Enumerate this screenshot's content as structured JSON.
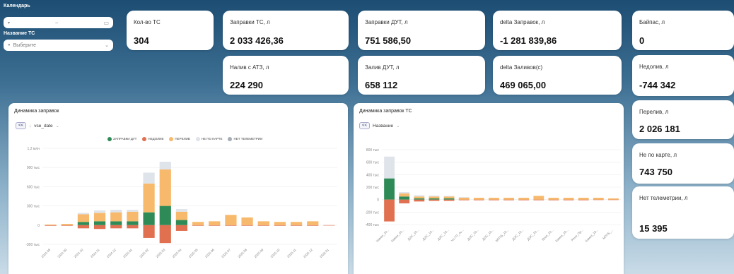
{
  "filters": {
    "calendar_label": "Календарь",
    "calendar_value": "–",
    "vehicle_label": "Название ТС",
    "vehicle_placeholder": "Выберите"
  },
  "kpis": {
    "vehicles": {
      "label": "Кол-во ТС",
      "value": "304"
    },
    "refuel_vehicle": {
      "label": "Заправки ТС, л",
      "value": "2 033 426,36"
    },
    "refuel_dut": {
      "label": "Заправки ДУТ, л",
      "value": "751 586,50"
    },
    "delta_refuel": {
      "label": "delta Заправок, л",
      "value": "-1 281 839,86"
    },
    "bypass": {
      "label": "Байпас, л",
      "value": "0"
    },
    "atz_fill": {
      "label": "Налив с АТЗ, л",
      "value": "224 290"
    },
    "dut_fill": {
      "label": "Залив ДУТ, л",
      "value": "658 112"
    },
    "delta_fill": {
      "label": "delta Заливов(с)",
      "value": "469 065,00"
    },
    "underfill": {
      "label": "Недолив, л",
      "value": "-744 342"
    },
    "overfill": {
      "label": "Перелив, л",
      "value": "2 026 181"
    },
    "off_card": {
      "label": "Не по карте, л",
      "value": "743 750"
    },
    "no_telemetry": {
      "label": "Нет телеметрии, л",
      "value": "15 395"
    }
  },
  "chart1": {
    "title": "Динамика заправок",
    "back_label": "<<",
    "field_label": "vse_date",
    "legend": [
      "ЗАПРАВКИ ДУТ",
      "НЕДОЛИВ",
      "ПЕРЕЛИВ",
      "НЕ ПО КАРТЕ",
      "НЕТ ТЕЛЕМЕТРИИ"
    ]
  },
  "chart2": {
    "title": "Динамика заправок ТС",
    "back_label": "<<",
    "field_label": "Название"
  },
  "colors": {
    "dut": "#2e8b57",
    "underfill": "#e07050",
    "overfill": "#f7b96b",
    "off_card": "#dfe3ea",
    "no_telemetry": "#a7adb5"
  },
  "chart_data": [
    {
      "type": "bar",
      "stacked": true,
      "title": "Динамика заправок",
      "ytick_labels": [
        "1,2 млн",
        "900 тыс",
        "600 тыс",
        "300 тыс",
        "0",
        "-300 тыс"
      ],
      "yticks": [
        1200000,
        900000,
        600000,
        300000,
        0,
        -300000
      ],
      "ylim": [
        -300000,
        1200000
      ],
      "categories": [
        "2024.08",
        "2024.09",
        "2024.10",
        "2024.11",
        "2024.12",
        "2025.01",
        "2025.02",
        "2025.03",
        "2025.04",
        "2025.05",
        "2025.06",
        "2025.07",
        "2025.08",
        "2025.09",
        "2025.10",
        "2025.11",
        "2025.12",
        "2026.01"
      ],
      "series": [
        {
          "name": "ЗАПРАВКИ ДУТ",
          "color": "#2e8b57",
          "values": [
            0,
            0,
            50000,
            60000,
            60000,
            60000,
            200000,
            300000,
            80000,
            0,
            0,
            0,
            0,
            0,
            0,
            0,
            0,
            0
          ]
        },
        {
          "name": "НЕДОЛИВ",
          "color": "#e07050",
          "values": [
            -10000,
            -10000,
            -50000,
            -60000,
            -50000,
            -50000,
            -200000,
            -280000,
            -90000,
            -10000,
            -10000,
            -10000,
            -10000,
            -10000,
            -10000,
            -10000,
            -10000,
            -5000
          ]
        },
        {
          "name": "ПЕРЕЛИВ",
          "color": "#f7b96b",
          "values": [
            10000,
            20000,
            120000,
            130000,
            140000,
            150000,
            450000,
            570000,
            130000,
            50000,
            60000,
            160000,
            120000,
            60000,
            50000,
            50000,
            60000,
            0
          ]
        },
        {
          "name": "НЕ ПО КАРТЕ",
          "color": "#dfe3ea",
          "values": [
            0,
            0,
            20000,
            40000,
            40000,
            30000,
            170000,
            120000,
            40000,
            0,
            0,
            0,
            0,
            0,
            0,
            0,
            0,
            0
          ]
        },
        {
          "name": "НЕТ ТЕЛЕМЕТРИИ",
          "color": "#a7adb5",
          "values": [
            0,
            0,
            0,
            0,
            0,
            0,
            0,
            0,
            0,
            0,
            0,
            0,
            0,
            0,
            0,
            0,
            0,
            0
          ]
        }
      ]
    },
    {
      "type": "bar",
      "stacked": true,
      "title": "Динамика заправок ТС",
      "ytick_labels": [
        "800 тыс",
        "600 тыс",
        "400 тыс",
        "200 тыс",
        "0",
        "-200 тыс",
        "-400 тыс"
      ],
      "yticks": [
        800000,
        600000,
        400000,
        200000,
        0,
        -200000,
        -400000
      ],
      "ylim": [
        -400000,
        800000
      ],
      "categories": [
        "Камаз_10...",
        "Камаз_10...",
        "ДЭС_10...",
        "ДЭС_10...",
        "ДЭС_10...",
        "Чэ ГП_ль...",
        "ДЭС_10...",
        "ДЭС_10...",
        "МПТБ_10...",
        "ДЭС_10...",
        "ДЭС_10...",
        "Урал_10...",
        "Камаз_10...",
        "Рено_Пр...",
        "Камаз_10...",
        "МПТБ_..."
      ],
      "series": [
        {
          "name": "ЗАПРАВКИ ДУТ",
          "color": "#2e8b57",
          "values": [
            340000,
            50000,
            20000,
            20000,
            20000,
            0,
            0,
            0,
            0,
            0,
            0,
            0,
            0,
            0,
            0,
            0
          ]
        },
        {
          "name": "НЕДОЛИВ",
          "color": "#e07050",
          "values": [
            -350000,
            -60000,
            -30000,
            -20000,
            -20000,
            -10000,
            -10000,
            -10000,
            -10000,
            -10000,
            -10000,
            -10000,
            -10000,
            -10000,
            -5000,
            -5000
          ]
        },
        {
          "name": "ПЕРЕЛИВ",
          "color": "#f7b96b",
          "values": [
            0,
            50000,
            30000,
            30000,
            30000,
            30000,
            30000,
            30000,
            30000,
            30000,
            60000,
            30000,
            30000,
            30000,
            30000,
            20000
          ]
        },
        {
          "name": "НЕ ПО КАРТЕ",
          "color": "#dfe3ea",
          "values": [
            350000,
            20000,
            20000,
            15000,
            10000,
            10000,
            0,
            0,
            0,
            0,
            0,
            0,
            0,
            0,
            0,
            0
          ]
        },
        {
          "name": "НЕТ ТЕЛЕМЕТРИИ",
          "color": "#a7adb5",
          "values": [
            0,
            0,
            0,
            0,
            0,
            0,
            0,
            0,
            0,
            0,
            0,
            0,
            0,
            0,
            0,
            0
          ]
        }
      ]
    }
  ]
}
